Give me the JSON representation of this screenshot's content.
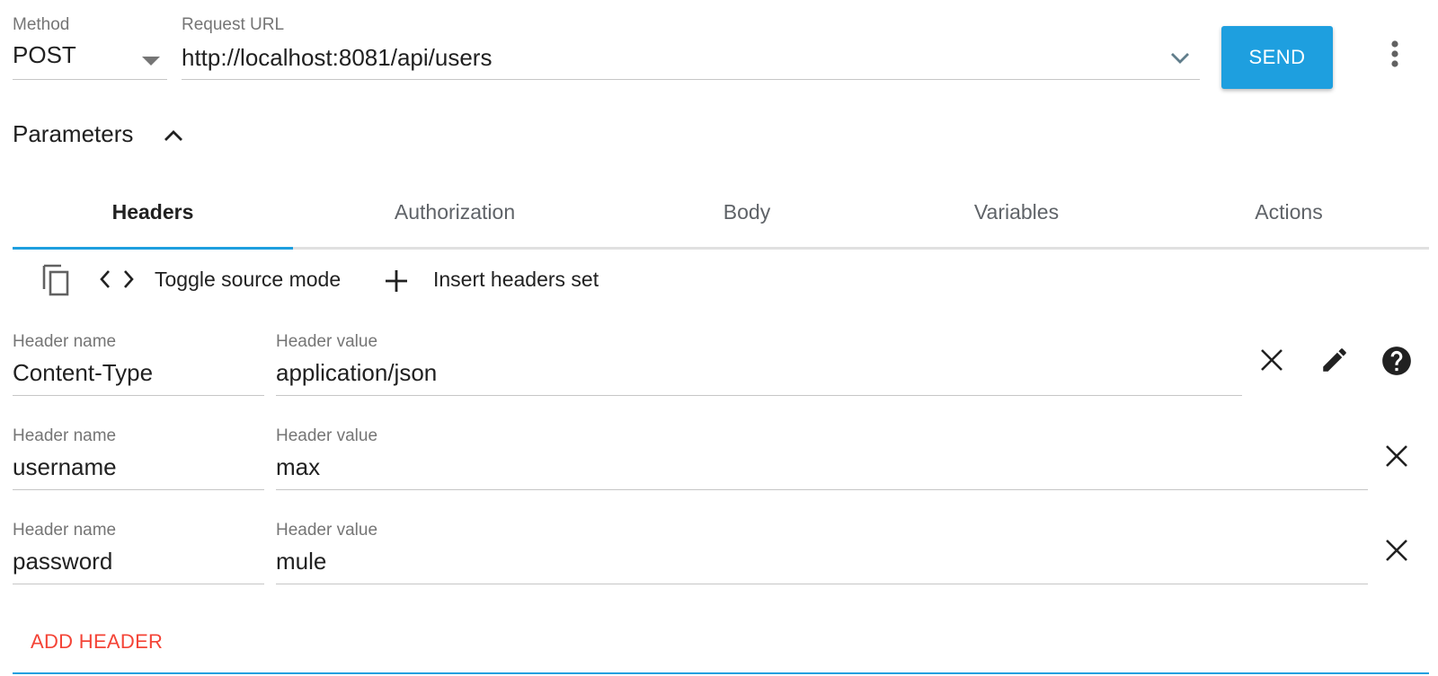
{
  "request": {
    "method_label": "Method",
    "method_value": "POST",
    "url_label": "Request URL",
    "url_value": "http://localhost:8081/api/users",
    "send_label": "SEND"
  },
  "parameters": {
    "title": "Parameters"
  },
  "tabs": [
    {
      "label": "Headers",
      "active": true
    },
    {
      "label": "Authorization",
      "active": false
    },
    {
      "label": "Body",
      "active": false
    },
    {
      "label": "Variables",
      "active": false
    },
    {
      "label": "Actions",
      "active": false
    }
  ],
  "toolbar": {
    "toggle_label": "Toggle source mode",
    "insert_label": "Insert headers set"
  },
  "headers": [
    {
      "name_label": "Header name",
      "name": "Content-Type",
      "value_label": "Header value",
      "value": "application/json"
    },
    {
      "name_label": "Header name",
      "name": "username",
      "value_label": "Header value",
      "value": "max"
    },
    {
      "name_label": "Header name",
      "name": "password",
      "value_label": "Header value",
      "value": "mule"
    }
  ],
  "add_header_label": "ADD HEADER",
  "colors": {
    "accent": "#1e9fdf",
    "add_header": "#f44336",
    "text": "#212121",
    "muted": "#757575"
  },
  "icons": [
    "dropdown-arrow-icon",
    "chevron-down-icon",
    "more-vert-icon",
    "chevron-up-icon",
    "copy-icon",
    "code-icon",
    "plus-icon",
    "close-icon",
    "edit-icon",
    "help-icon"
  ]
}
